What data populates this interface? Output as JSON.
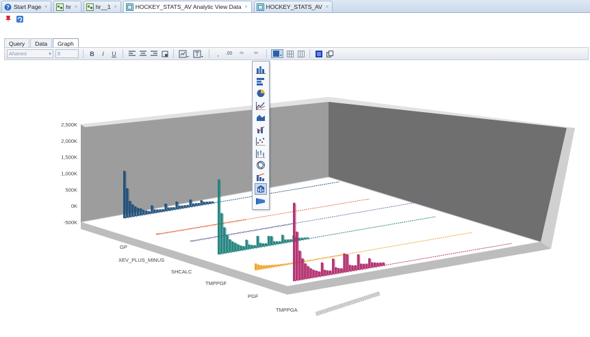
{
  "tabs": [
    {
      "label": "Start Page",
      "icon": "help-icon",
      "active": false
    },
    {
      "label": "hr",
      "icon": "db-connection-icon",
      "active": false
    },
    {
      "label": "hr__1",
      "icon": "db-connection-icon",
      "active": false
    },
    {
      "label": "HOCKEY_STATS_AV Analytic View Data",
      "icon": "analytic-view-icon",
      "active": true
    },
    {
      "label": "HOCKEY_STATS_AV",
      "icon": "analytic-view-icon",
      "active": false
    }
  ],
  "inner_tabs": [
    {
      "label": "Query",
      "active": false
    },
    {
      "label": "Data",
      "active": false
    },
    {
      "label": "Graph",
      "active": true
    }
  ],
  "format_toolbar": {
    "font_value": "Aharoni",
    "size_value": "8",
    "bold": "B",
    "italic": "I",
    "underline": "U"
  },
  "dropdown_items": [
    "bar-chart-icon",
    "horizontal-bar-icon",
    "pie-chart-icon",
    "line-chart-icon",
    "area-chart-icon",
    "combo-chart-icon",
    "scatter-chart-icon",
    "stock-chart-icon",
    "radar-chart-icon",
    "pareto-chart-icon",
    "3d-chart-icon",
    "funnel-chart-icon"
  ],
  "colors": {
    "accent": "#1f4e79",
    "series": [
      "#1f4e79",
      "#e06a3a",
      "#6a6fa0",
      "#1c7f7a",
      "#f0a020",
      "#b02a6a"
    ]
  },
  "chart_data": {
    "type": "bar",
    "variant": "3d",
    "y_ticks": [
      "2,500K",
      "2,000K",
      "1,500K",
      "1,000K",
      "500K",
      "0K",
      "-500K"
    ],
    "ylim": [
      -500000,
      2500000
    ],
    "depth_labels": [
      "GP",
      "XEV_PLUS_MINUS",
      "SHCALC",
      "TMPPGF",
      "PGF",
      "TMPPGA"
    ],
    "series": [
      {
        "name": "GP",
        "color": "#1f4e79",
        "values": [
          1450000,
          900000,
          500000,
          380000,
          300000,
          240000,
          210000,
          150000,
          120000,
          90000,
          250000,
          110000,
          95000,
          85000,
          80000,
          230000,
          100000,
          90000,
          80000,
          240000,
          100000,
          90000,
          85000,
          80000,
          230000,
          95000,
          90000,
          80000,
          150000,
          90000,
          80000,
          70000,
          60000
        ]
      },
      {
        "name": "XEV_PLUS_MINUS",
        "color": "#e06a3a",
        "values": [
          30000,
          25000,
          20000,
          20000,
          18000,
          15000,
          15000,
          12000,
          12000,
          10000,
          10000,
          10000,
          9000,
          9000,
          8000,
          8000,
          8000,
          7000,
          7000,
          6000,
          6000,
          6000,
          5000,
          5000,
          5000,
          4000,
          4000,
          4000,
          3000,
          3000,
          3000,
          2000,
          2000
        ]
      },
      {
        "name": "SHCALC",
        "color": "#6a6fa0",
        "values": [
          25000,
          22000,
          20000,
          18000,
          16000,
          15000,
          14000,
          13000,
          12000,
          11000,
          10000,
          9000,
          9000,
          8000,
          8000,
          7000,
          7000,
          6000,
          6000,
          5000,
          5000,
          5000,
          4000,
          4000,
          4000,
          3000,
          3000,
          3000,
          2000,
          2000,
          2000,
          1000,
          1000
        ]
      },
      {
        "name": "TMPPGF",
        "color": "#1c7f7a",
        "values": [
          2300000,
          1250000,
          800000,
          550000,
          400000,
          320000,
          260000,
          200000,
          150000,
          120000,
          300000,
          140000,
          110000,
          90000,
          360000,
          130000,
          100000,
          90000,
          300000,
          280000,
          110000,
          90000,
          80000,
          260000,
          100000,
          90000,
          80000,
          180000,
          90000,
          80000,
          70000,
          60000,
          50000
        ]
      },
      {
        "name": "PGF",
        "color": "#f0a020",
        "values": [
          200000,
          150000,
          120000,
          100000,
          90000,
          80000,
          70000,
          60000,
          55000,
          50000,
          45000,
          40000,
          38000,
          35000,
          32000,
          30000,
          28000,
          26000,
          24000,
          22000,
          20000,
          19000,
          18000,
          17000,
          16000,
          15000,
          14000,
          13000,
          12000,
          11000,
          10000,
          9000,
          8000
        ]
      },
      {
        "name": "TMPPGA",
        "color": "#b02a6a",
        "values": [
          2400000,
          1500000,
          900000,
          650000,
          480000,
          380000,
          300000,
          240000,
          200000,
          160000,
          420000,
          180000,
          150000,
          130000,
          480000,
          200000,
          160000,
          140000,
          580000,
          540000,
          200000,
          170000,
          160000,
          480000,
          180000,
          160000,
          150000,
          300000,
          160000,
          140000,
          120000,
          110000,
          100000
        ]
      }
    ],
    "legend": "none",
    "grid": false
  }
}
